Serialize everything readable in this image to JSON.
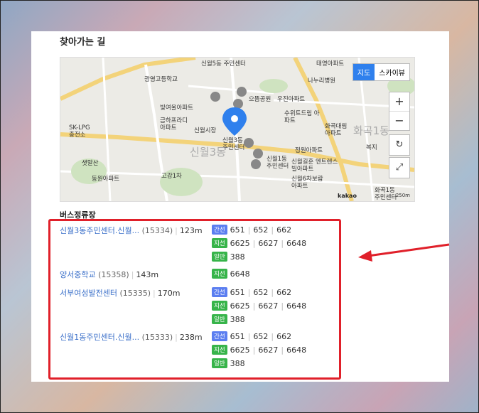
{
  "heading": "찾아가는 길",
  "map": {
    "type_buttons": [
      "지도",
      "스카이뷰"
    ],
    "zoom_in": "+",
    "zoom_out": "−",
    "kakao": "kakao",
    "scale": "250m",
    "labels": [
      "신월5동 주민센터",
      "태영아파트",
      "나누리병원",
      "광영고등학교",
      "으뜸공원",
      "우진아파트",
      "빛여울아파트",
      "금하프라디 아파트",
      "신월시장",
      "수위트드림 아파트",
      "화곡대림 아파트",
      "SK-LPG 충전소",
      "신월3동 주민센터",
      "신월1동 주민센터",
      "정원아파트",
      "신월길훈 엔트렌스빌아파트",
      "신월6차보람 아파트",
      "화곡1동 주민센터",
      "샛말산",
      "동원아파트",
      "고강1차",
      "복지"
    ],
    "district_labels": [
      "신월3동",
      "화곡1동"
    ]
  },
  "section_title": "버스정류장",
  "stops": [
    {
      "name": "신월3동주민센터.신월...",
      "code": "(15334)",
      "dist": "123m",
      "routes": [
        {
          "type": "간선",
          "cls": "main",
          "nums": [
            "651",
            "652",
            "662"
          ]
        },
        {
          "type": "지선",
          "cls": "branch",
          "nums": [
            "6625",
            "6627",
            "6648"
          ]
        },
        {
          "type": "일반",
          "cls": "normal",
          "nums": [
            "388"
          ]
        }
      ]
    },
    {
      "name": "양서중학교",
      "code": "(15358)",
      "dist": "143m",
      "routes": [
        {
          "type": "지선",
          "cls": "branch",
          "nums": [
            "6648"
          ]
        }
      ]
    },
    {
      "name": "서부여성발전센터",
      "code": "(15335)",
      "dist": "170m",
      "routes": [
        {
          "type": "간선",
          "cls": "main",
          "nums": [
            "651",
            "652",
            "662"
          ]
        },
        {
          "type": "지선",
          "cls": "branch",
          "nums": [
            "6625",
            "6627",
            "6648"
          ]
        },
        {
          "type": "일반",
          "cls": "normal",
          "nums": [
            "388"
          ]
        }
      ]
    },
    {
      "name": "신월1동주민센터.신월...",
      "code": "(15333)",
      "dist": "238m",
      "routes": [
        {
          "type": "간선",
          "cls": "main",
          "nums": [
            "651",
            "652",
            "662"
          ]
        },
        {
          "type": "지선",
          "cls": "branch",
          "nums": [
            "6625",
            "6627",
            "6648"
          ]
        },
        {
          "type": "일반",
          "cls": "normal",
          "nums": [
            "388"
          ]
        }
      ]
    }
  ],
  "colors": {
    "highlight": "#e0202a",
    "link": "#3a6fc9",
    "badge_main": "#5b7ef0",
    "badge_branch": "#37b44a",
    "marker": "#2f80ed"
  }
}
